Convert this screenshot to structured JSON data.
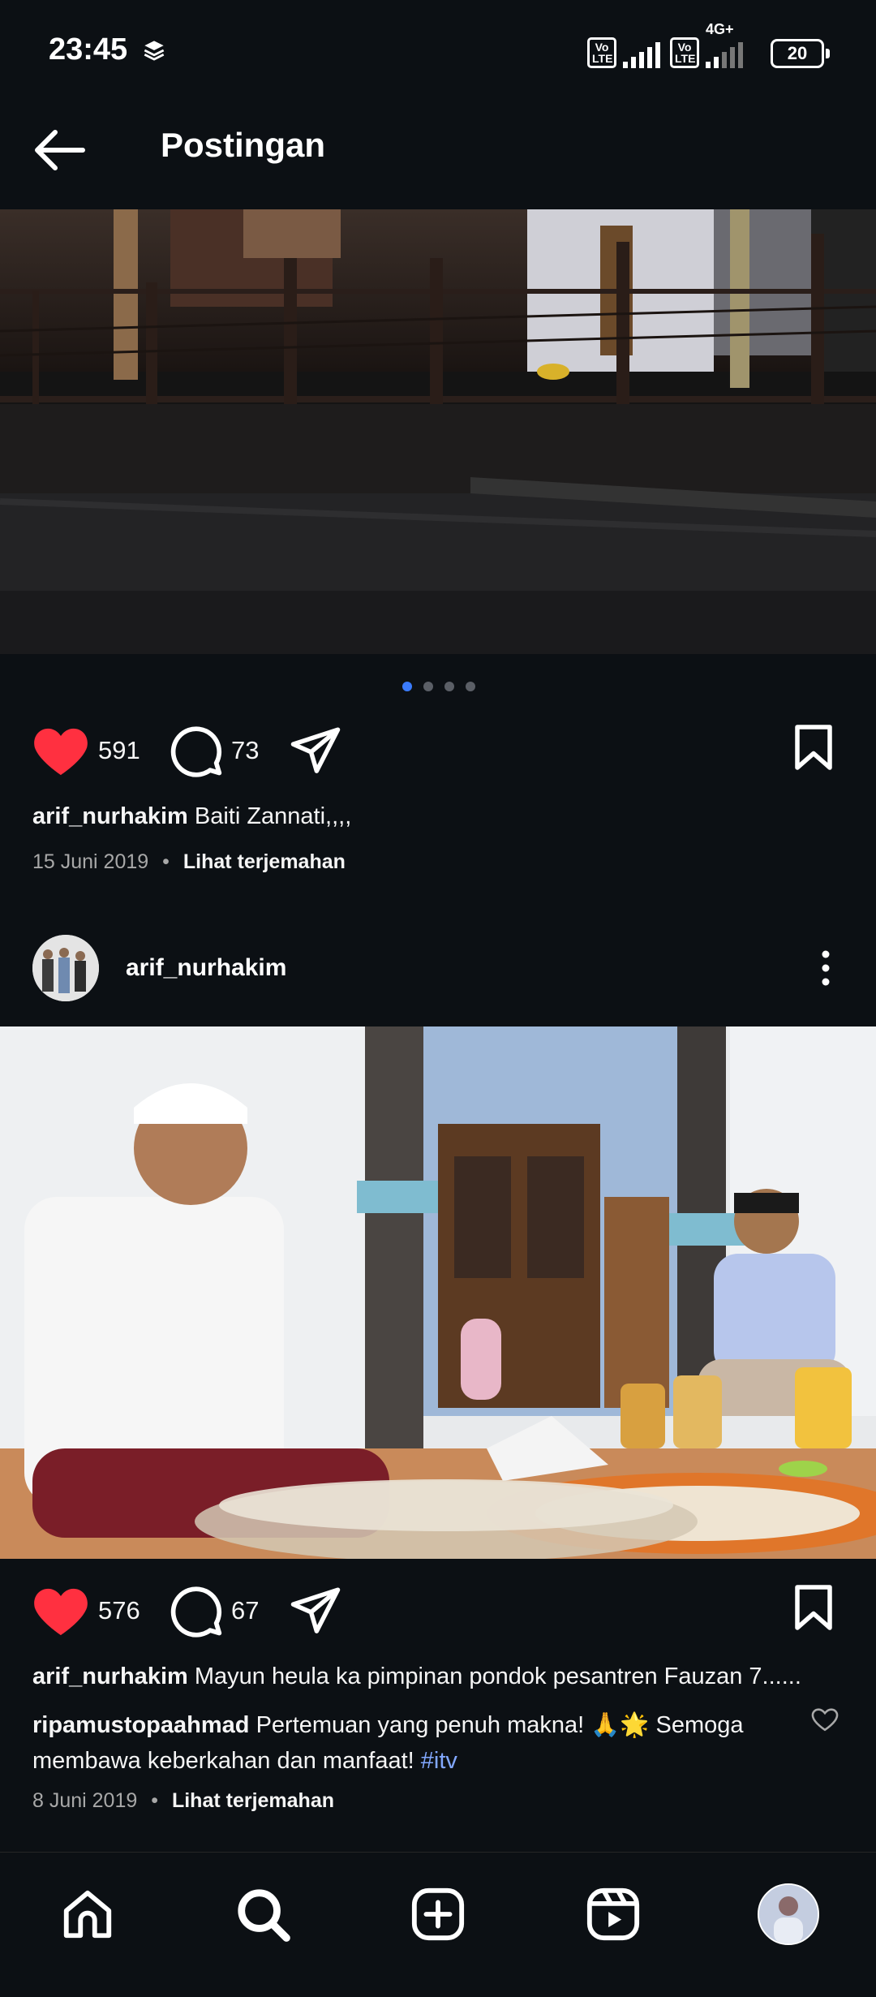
{
  "status_bar": {
    "time": "23:45",
    "sim1_label": "Vo LTE",
    "sim2_label": "Vo LTE",
    "network": "4G+",
    "battery": "20"
  },
  "header": {
    "title": "Postingan",
    "back_icon": "arrow-left-icon"
  },
  "post1": {
    "carousel_pages": 4,
    "carousel_active": 1,
    "likes": "591",
    "comments": "73",
    "username": "arif_nurhakim",
    "caption": "Baiti Zannati,,,,",
    "date": "15 Juni 2019",
    "see_translation": "Lihat terjemahan"
  },
  "post2": {
    "username": "arif_nurhakim",
    "likes": "576",
    "comments": "67",
    "caption_user": "arif_nurhakim",
    "caption": "Mayun heula ka pimpinan pondok pesantren Fauzan 7......",
    "comment_user": "ripamustopaahmad",
    "comment_line1": "Pertemuan yang penuh makna! 🙏🌟 Semoga",
    "comment_line2": "membawa keberkahan dan manfaat!",
    "comment_hashtag": "#itv",
    "date": "8 Juni 2019",
    "see_translation": "Lihat terjemahan"
  },
  "nav": {
    "items": [
      "home-icon",
      "search-icon",
      "create-icon",
      "reels-icon",
      "profile-avatar"
    ]
  },
  "colors": {
    "background": "#0c1014",
    "like_red": "#ff3040",
    "carousel_active": "#3a7bfd",
    "hashtag": "#82a8ff"
  }
}
